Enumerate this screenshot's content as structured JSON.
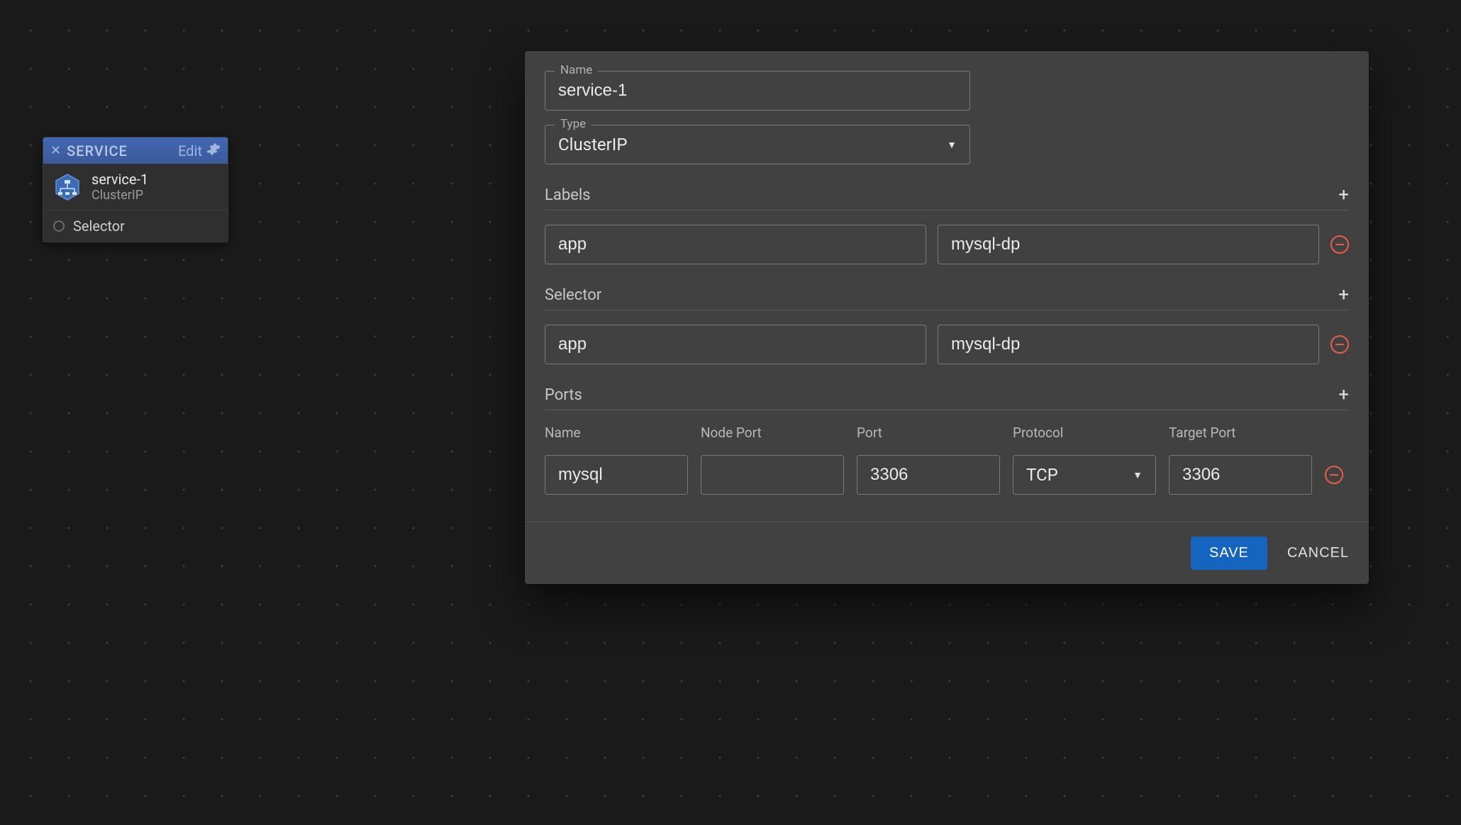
{
  "node": {
    "header_title": "SERVICE",
    "edit_label": "Edit",
    "name": "service-1",
    "subtype": "ClusterIP",
    "selector_label": "Selector"
  },
  "form": {
    "name_label": "Name",
    "name_value": "service-1",
    "type_label": "Type",
    "type_value": "ClusterIP",
    "labels_header": "Labels",
    "labels": [
      {
        "key": "app",
        "value": "mysql-dp"
      }
    ],
    "selector_header": "Selector",
    "selectors": [
      {
        "key": "app",
        "value": "mysql-dp"
      }
    ],
    "ports_header": "Ports",
    "port_columns": {
      "name": "Name",
      "nodePort": "Node Port",
      "port": "Port",
      "protocol": "Protocol",
      "targetPort": "Target Port"
    },
    "ports": [
      {
        "name": "mysql",
        "nodePort": "",
        "port": "3306",
        "protocol": "TCP",
        "targetPort": "3306"
      }
    ],
    "save_label": "SAVE",
    "cancel_label": "CANCEL"
  }
}
